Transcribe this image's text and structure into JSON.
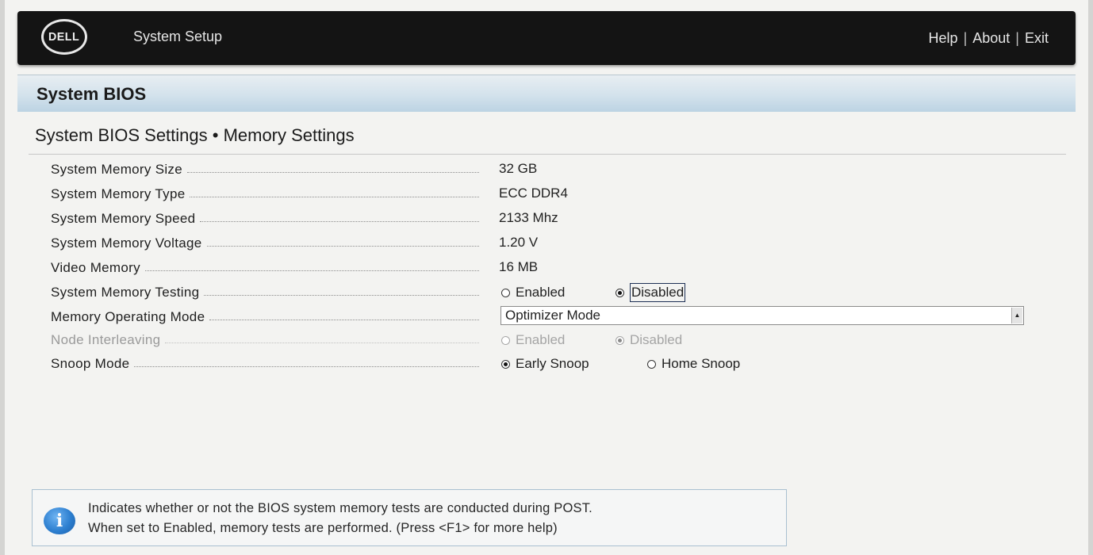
{
  "header": {
    "logo_text": "DELL",
    "app_title": "System Setup",
    "links": [
      "Help",
      "About",
      "Exit"
    ],
    "separator": "|"
  },
  "section": {
    "title": "System BIOS",
    "subtitle": "System BIOS Settings • Memory Settings"
  },
  "settings": {
    "memory_size": {
      "label": "System Memory Size",
      "value": "32 GB"
    },
    "memory_type": {
      "label": "System Memory Type",
      "value": "ECC DDR4"
    },
    "memory_speed": {
      "label": "System Memory Speed",
      "value": "2133 Mhz"
    },
    "memory_voltage": {
      "label": "System Memory Voltage",
      "value": "1.20 V"
    },
    "video_memory": {
      "label": "Video Memory",
      "value": "16 MB"
    },
    "memory_testing": {
      "label": "System Memory Testing",
      "options": [
        "Enabled",
        "Disabled"
      ],
      "selected": "Disabled"
    },
    "operating_mode": {
      "label": "Memory Operating Mode",
      "value": "Optimizer Mode"
    },
    "node_interleaving": {
      "label": "Node Interleaving",
      "options": [
        "Enabled",
        "Disabled"
      ],
      "selected": "Disabled",
      "disabled": true
    },
    "snoop_mode": {
      "label": "Snoop Mode",
      "options": [
        "Early Snoop",
        "Home Snoop"
      ],
      "selected": "Early Snoop"
    }
  },
  "help": {
    "icon": "info-icon",
    "icon_glyph": "i",
    "line1": "Indicates whether or not the BIOS system memory tests are conducted during POST.",
    "line2": "When set to Enabled, memory tests are performed. (Press <F1> for more help)"
  },
  "colors": {
    "header_bg": "#141414",
    "band_gradient_end": "#bcd3e3",
    "info_blue": "#2d7fd0"
  }
}
